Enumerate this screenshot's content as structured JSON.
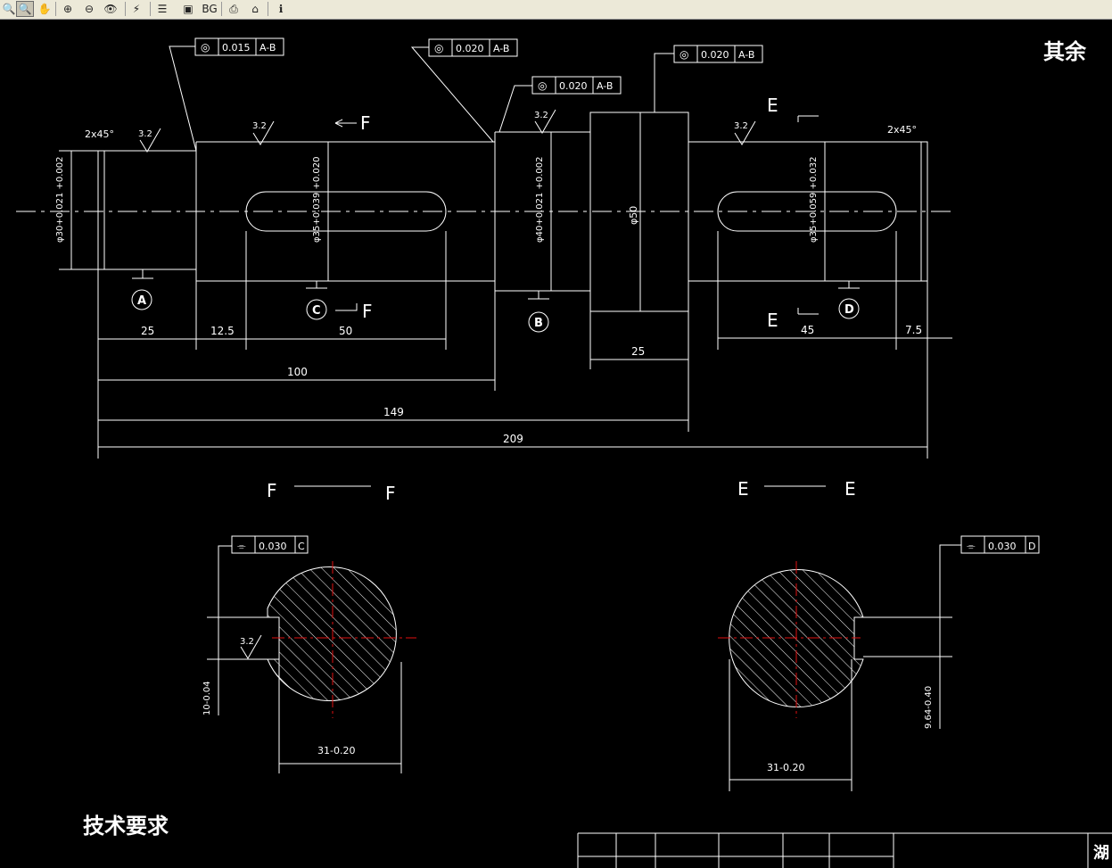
{
  "toolbar": {
    "buttons": [
      {
        "id": "zoom-icon",
        "glyph": "🔍"
      },
      {
        "id": "zoom-window-icon",
        "glyph": "🔍"
      },
      {
        "id": "pan-icon",
        "glyph": "✋"
      },
      {
        "id": "zoom-in-icon",
        "glyph": "⊕"
      },
      {
        "id": "zoom-extent-icon",
        "glyph": "⊖"
      },
      {
        "id": "eye-icon",
        "glyph": "👁"
      },
      {
        "id": "lightning-icon",
        "glyph": "⚡"
      },
      {
        "id": "layers-icon",
        "glyph": "☰"
      },
      {
        "id": "frame-icon",
        "glyph": "▣"
      },
      {
        "id": "bg-button",
        "glyph": "BG"
      },
      {
        "id": "print-icon",
        "glyph": "⎙"
      },
      {
        "id": "home-icon",
        "glyph": "⌂"
      },
      {
        "id": "info-icon",
        "glyph": "ℹ"
      }
    ]
  },
  "drawing": {
    "remaining_label": "其余",
    "tech_requirements": "技术要求",
    "title_block_partial": "湖",
    "chamfer": "2x45°",
    "roughness": "3.2",
    "tol_1": {
      "symbol": "◎",
      "value": "0.015",
      "datum": "A-B"
    },
    "tol_2": {
      "symbol": "◎",
      "value": "0.020",
      "datum": "A-B"
    },
    "tol_3": {
      "symbol": "◎",
      "value": "0.020",
      "datum": "A-B"
    },
    "tol_4": {
      "symbol": "◎",
      "value": "0.020",
      "datum": "A-B"
    },
    "tol_5": {
      "symbol": "⌯",
      "value": "0.030",
      "datum": "C"
    },
    "tol_6": {
      "symbol": "⌯",
      "value": "0.030",
      "datum": "D"
    },
    "datums": [
      "A",
      "B",
      "C",
      "D"
    ],
    "section_F": "F",
    "section_E": "E",
    "diameters": {
      "d30": "φ30+0.021 +0.002",
      "d35a": "φ35+0.039 +0.020",
      "d40": "φ40+0.021 +0.002",
      "d50": "φ50",
      "d35b": "φ35+0.059 +0.032"
    },
    "dims": {
      "d25": "25",
      "d12_5": "12.5",
      "d50": "50",
      "d100": "100",
      "d149": "149",
      "d209": "209",
      "d25b": "25",
      "d45": "45",
      "d7_5": "7.5"
    },
    "section_dims": {
      "s1_width": "31-0.20",
      "s1_depth": "10-0.04",
      "s2_width": "31-0.20",
      "s2_depth": "9.64-0.40"
    }
  }
}
